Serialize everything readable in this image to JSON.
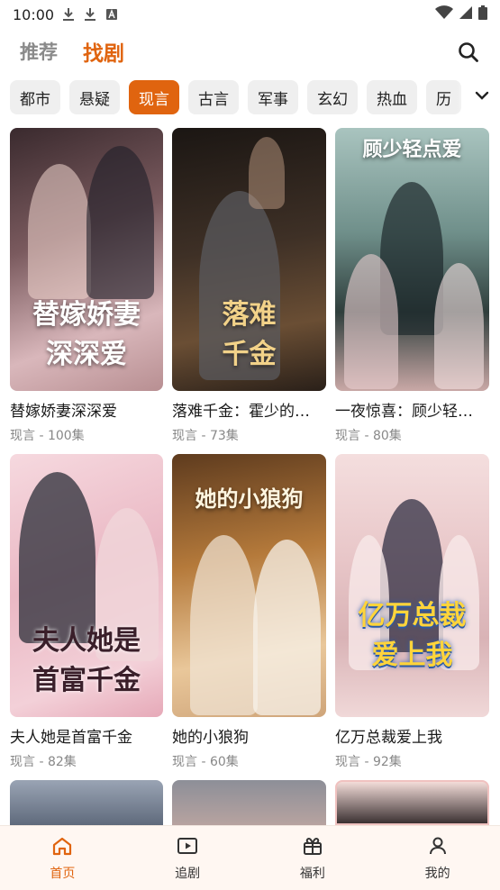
{
  "status": {
    "time": "10:00",
    "icons": [
      "download-icon",
      "download-icon",
      "keyboard-a-icon",
      "wifi-icon",
      "signal-icon",
      "battery-icon"
    ]
  },
  "top_tabs": [
    {
      "label": "推荐",
      "active": false
    },
    {
      "label": "找剧",
      "active": true
    }
  ],
  "chips": [
    {
      "label": "都市",
      "active": false
    },
    {
      "label": "悬疑",
      "active": false
    },
    {
      "label": "现言",
      "active": true
    },
    {
      "label": "古言",
      "active": false
    },
    {
      "label": "军事",
      "active": false
    },
    {
      "label": "玄幻",
      "active": false
    },
    {
      "label": "热血",
      "active": false
    },
    {
      "label": "历",
      "active": false
    }
  ],
  "dramas": [
    {
      "title": "替嫁娇妻深深爱",
      "meta": "现言 - 100集",
      "poster_text": "替嫁娇妻\n深深爱"
    },
    {
      "title": "落难千金：霍少的…",
      "meta": "现言 - 73集",
      "poster_text": "落难\n千金"
    },
    {
      "title": "一夜惊喜：顾少轻…",
      "meta": "现言 - 80集",
      "poster_text": "顾少轻点爱"
    },
    {
      "title": "夫人她是首富千金",
      "meta": "现言 - 82集",
      "poster_text": "夫人她是\n首富千金"
    },
    {
      "title": "她的小狼狗",
      "meta": "现言 - 60集",
      "poster_text": "她的小狼狗"
    },
    {
      "title": "亿万总裁爱上我",
      "meta": "现言 - 92集",
      "poster_text": "亿万总裁\n爱上我"
    }
  ],
  "colors": {
    "accent": "#e0640f"
  },
  "bottom_nav": [
    {
      "label": "首页",
      "icon": "home-icon",
      "active": true
    },
    {
      "label": "追剧",
      "icon": "play-icon",
      "active": false
    },
    {
      "label": "福利",
      "icon": "gift-icon",
      "active": false
    },
    {
      "label": "我的",
      "icon": "user-icon",
      "active": false
    }
  ]
}
